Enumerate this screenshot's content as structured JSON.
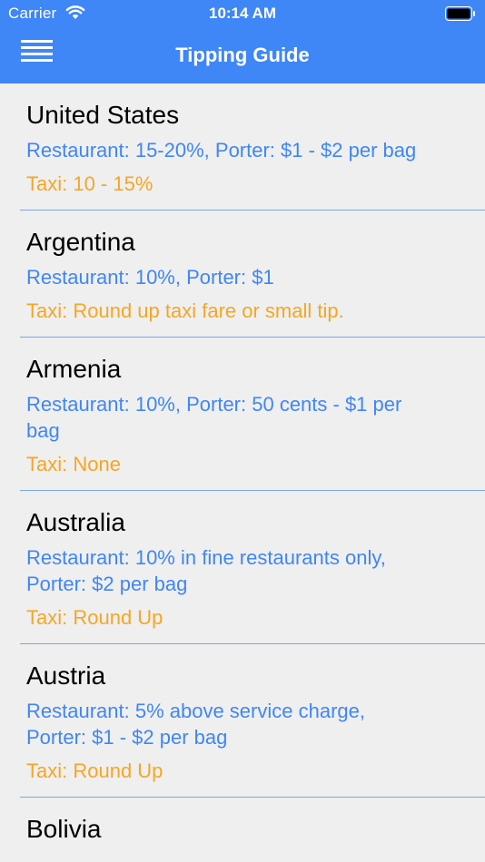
{
  "status_bar": {
    "carrier": "Carrier",
    "time": "10:14 AM",
    "wifi_icon": "wifi-icon",
    "battery_icon": "battery-icon"
  },
  "nav": {
    "title": "Tipping Guide",
    "menu_icon": "hamburger-menu-icon"
  },
  "colors": {
    "nav_background": "#3f86f7",
    "info_text": "#3f86f7",
    "taxi_text": "#f5a623",
    "list_background": "#efefef",
    "separator": "#7aa6ea"
  },
  "countries": [
    {
      "name": "United States",
      "info": "Restaurant: 15-20%,  Porter:  $1 - $2 per bag",
      "taxi": "Taxi:  10 - 15%"
    },
    {
      "name": "Argentina",
      "info": "Restaurant: 10%,  Porter:  $1",
      "taxi": "Taxi:  Round up taxi fare or small tip."
    },
    {
      "name": "Armenia",
      "info": "Restaurant: 10%,  Porter:  50 cents - $1 per bag",
      "taxi": "Taxi:  None"
    },
    {
      "name": "Australia",
      "info": "Restaurant: 10% in fine restaurants only, Porter:  $2 per bag",
      "taxi": "Taxi:  Round Up"
    },
    {
      "name": "Austria",
      "info": "Restaurant: 5% above service charge, Porter:  $1 - $2 per bag",
      "taxi": "Taxi:  Round Up"
    },
    {
      "name": "Bolivia",
      "info": "",
      "taxi": ""
    }
  ]
}
